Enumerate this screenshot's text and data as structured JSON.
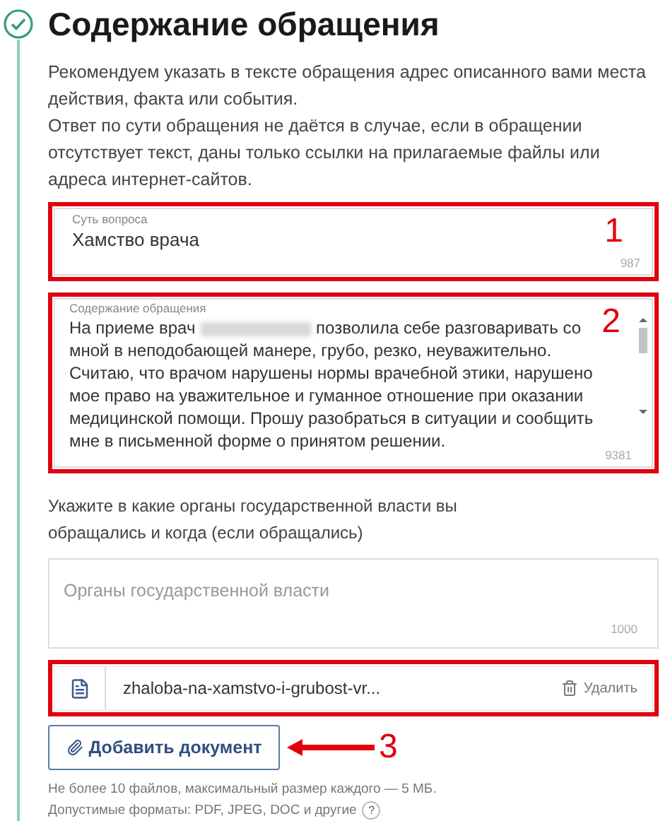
{
  "section": {
    "title": "Содержание обращения",
    "completed": true
  },
  "intro": [
    "Рекомендуем указать в тексте обращения адрес описанного вами места действия, факта или события.",
    "Ответ по сути обращения не даётся в случае, если в обращении отсутствует текст, даны только ссылки на прилагаемые файлы или адреса интернет-сайтов."
  ],
  "subject_field": {
    "label": "Суть вопроса",
    "value": "Хамство врача",
    "counter": "987",
    "annotation": "1"
  },
  "content_field": {
    "label": "Содержание обращения",
    "counter": "9381",
    "annotation": "2",
    "segments": [
      {
        "kind": "text",
        "text": "На приеме врач"
      },
      {
        "kind": "blurred"
      },
      {
        "kind": "text",
        "text": "позволила себе разговаривать со мной в неподобающей манере, грубо, резко, неуважительно. Считаю, что врачом нарушены нормы врачебной этики, нарушено мое право на уважительное и гуманное отношение при оказании медицинской помощи. Прошу разобраться в ситуации и сообщить мне в письменной форме о принятом решении."
      }
    ]
  },
  "authorities": {
    "prompt": "Укажите в какие органы государственной власти вы обращались и когда (если обращались)",
    "placeholder": "Органы государственной власти",
    "counter": "1000"
  },
  "attachment": {
    "file_name": "zhaloba-na-xamstvo-i-grubost-vr...",
    "delete_label": "Удалить",
    "annotated": true
  },
  "add_button": {
    "label": "Добавить документ",
    "annotation": "3"
  },
  "notes": [
    "Не более 10 файлов, максимальный размер каждого — 5 МБ.",
    "Допустимые форматы: PDF, JPEG, DOC и другие"
  ],
  "help": "?"
}
